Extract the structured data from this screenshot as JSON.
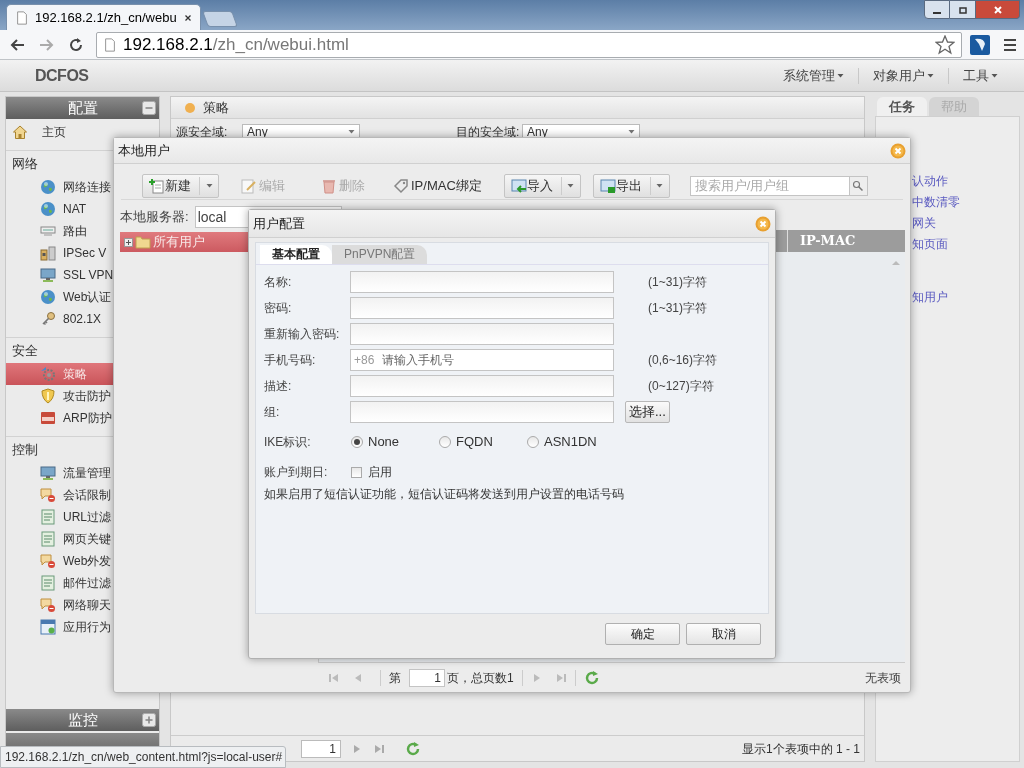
{
  "browser": {
    "tab_title": "192.168.2.1/zh_cn/webu",
    "url_host": "192.168.2.1",
    "url_path": "/zh_cn/webui.html",
    "status_url": "192.168.2.1/zh_cn/web_content.html?js=local-user#"
  },
  "header": {
    "logo": "DCFOS",
    "menus": [
      "系统管理",
      "对象用户",
      "工具"
    ]
  },
  "sidebar": {
    "panels": [
      {
        "title": "配置",
        "expanded": true
      },
      {
        "title": "监控",
        "expanded": false
      }
    ],
    "home": {
      "label": "主页",
      "selected": false
    },
    "groups": [
      {
        "title": "网络",
        "items": [
          {
            "label": "网络连接",
            "selected": false
          },
          {
            "label": "NAT",
            "selected": false
          },
          {
            "label": "路由",
            "selected": false
          },
          {
            "label": "IPSec V",
            "selected": false
          },
          {
            "label": "SSL VPN",
            "selected": false
          },
          {
            "label": "Web认证",
            "selected": false
          },
          {
            "label": "802.1X",
            "selected": false
          }
        ]
      },
      {
        "title": "安全",
        "items": [
          {
            "label": "策略",
            "selected": true
          },
          {
            "label": "攻击防护",
            "selected": false
          },
          {
            "label": "ARP防护",
            "selected": false
          }
        ]
      },
      {
        "title": "控制",
        "items": [
          {
            "label": "流量管理",
            "selected": false
          },
          {
            "label": "会话限制",
            "selected": false
          },
          {
            "label": "URL过滤",
            "selected": false
          },
          {
            "label": "网页关键",
            "selected": false
          },
          {
            "label": "Web外发",
            "selected": false
          },
          {
            "label": "邮件过滤",
            "selected": false
          },
          {
            "label": "网络聊天",
            "selected": false
          },
          {
            "label": "应用行为",
            "selected": false
          }
        ]
      }
    ]
  },
  "main": {
    "title": "策略",
    "filters": [
      {
        "label": "源安全域:",
        "value": "Any"
      },
      {
        "label": "目的安全域:",
        "value": "Any"
      }
    ],
    "pager": {
      "page": "1",
      "summary": "显示1个表项中的 1 - 1"
    }
  },
  "right_panel": {
    "tabs": [
      {
        "label": "任务",
        "selected": true
      },
      {
        "label": "帮助",
        "selected": false
      }
    ],
    "link_groups": [
      [
        "认动作",
        "中数清零",
        "网关",
        "知页面"
      ],
      [
        "知用户"
      ]
    ]
  },
  "local_users": {
    "title": "本地用户",
    "toolbar": [
      {
        "kind": "split",
        "label": "新建",
        "disabled": false
      },
      {
        "kind": "button",
        "label": "编辑",
        "disabled": true
      },
      {
        "kind": "button",
        "label": "删除",
        "disabled": true
      },
      {
        "kind": "button",
        "label": "IP/MAC绑定",
        "disabled": false
      },
      {
        "kind": "split",
        "label": "导入",
        "disabled": false
      },
      {
        "kind": "split",
        "label": "导出",
        "disabled": false
      }
    ],
    "search_placeholder": "搜索用户/用户组",
    "server_label": "本地服务器:",
    "server_value": "local",
    "tree": [
      {
        "label": "所有用户",
        "selected": true,
        "expanded": false
      }
    ],
    "columns": [
      "IP-MAC"
    ],
    "pager": {
      "page_prefix": "第",
      "page": "1",
      "page_suffix": "页，总页数1",
      "empty": "无表项"
    }
  },
  "user_config": {
    "title": "用户配置",
    "tabs": [
      {
        "label": "基本配置",
        "selected": true
      },
      {
        "label": "PnPVPN配置",
        "selected": false
      }
    ],
    "fields": [
      {
        "kind": "text",
        "label": "名称:",
        "hint": "(1~31)字符"
      },
      {
        "kind": "text",
        "label": "密码:",
        "hint": "(1~31)字符"
      },
      {
        "kind": "text",
        "label": "重新输入密码:"
      },
      {
        "kind": "phone",
        "label": "手机号码:",
        "prefix": "+86",
        "placeholder": "请输入手机号",
        "hint": "(0,6~16)字符"
      },
      {
        "kind": "text",
        "label": "描述:",
        "hint": "(0~127)字符"
      },
      {
        "kind": "select",
        "label": "组:",
        "button": "选择..."
      }
    ],
    "ike": {
      "label": "IKE标识:",
      "options": [
        {
          "label": "None",
          "selected": true
        },
        {
          "label": "FQDN",
          "selected": false
        },
        {
          "label": "ASN1DN",
          "selected": false
        }
      ]
    },
    "expiry": {
      "label": "账户到期日:",
      "checkbox_label": "启用",
      "checked": false
    },
    "note": "如果启用了短信认证功能，短信认证码将发送到用户设置的电话号码",
    "buttons": [
      "确定",
      "取消"
    ]
  }
}
